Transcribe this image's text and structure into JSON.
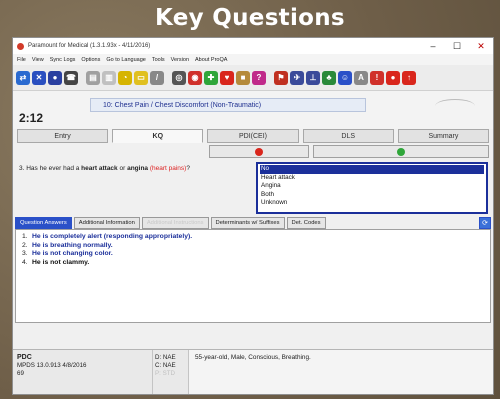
{
  "banner": {
    "title": "Key Questions"
  },
  "window": {
    "title": "Paramount for Medical (1.3.1.93x - 4/11/2016)",
    "controls": {
      "minimize": "–",
      "maximize": "☐",
      "close": "✕"
    }
  },
  "menu": [
    "File",
    "View",
    "Sync Logs",
    "Options",
    "Go to Language",
    "Tools",
    "Version",
    "About ProQA"
  ],
  "toolbar": {
    "icons": [
      {
        "name": "arrows-icon",
        "color": "#2a6ad0",
        "glyph": "⇄"
      },
      {
        "name": "cancel-icon",
        "color": "#2a4fc0",
        "glyph": "✕"
      },
      {
        "name": "case-icon",
        "color": "#2a3fa0",
        "glyph": "●"
      },
      {
        "name": "phone-icon",
        "color": "#444444",
        "glyph": "☎"
      },
      {
        "name": "notes-icon",
        "color": "#a0a0a0",
        "glyph": "▤"
      },
      {
        "name": "pdi-icon",
        "color": "#c0c0c0",
        "glyph": "▥"
      },
      {
        "name": "timer-icon",
        "color": "#d6b400",
        "glyph": "◔"
      },
      {
        "name": "card-icon",
        "color": "#e0c020",
        "glyph": "▭"
      },
      {
        "name": "pen-icon",
        "color": "#888888",
        "glyph": "/"
      },
      {
        "name": "record-icon",
        "color": "#555555",
        "glyph": "◎"
      },
      {
        "name": "recorder-icon",
        "color": "#d0302a",
        "glyph": "◉"
      },
      {
        "name": "aed-icon",
        "color": "#2fa63a",
        "glyph": "✚"
      },
      {
        "name": "heart-icon",
        "color": "#d9261c",
        "glyph": "♥"
      },
      {
        "name": "chest-icon",
        "color": "#b58a3a",
        "glyph": "■"
      },
      {
        "name": "help-icon",
        "color": "#c02a8a",
        "glyph": "?"
      },
      {
        "name": "flag-icon",
        "color": "#c03020",
        "glyph": "⚑"
      },
      {
        "name": "plane-icon",
        "color": "#3a4a9a",
        "glyph": "✈"
      },
      {
        "name": "unit-icon",
        "color": "#3a4a9a",
        "glyph": "⊥"
      },
      {
        "name": "map-icon",
        "color": "#2a8a3a",
        "glyph": "♣"
      },
      {
        "name": "globe-icon",
        "color": "#2a50c8",
        "glyph": "☺"
      },
      {
        "name": "font-icon",
        "color": "#888888",
        "glyph": "A"
      },
      {
        "name": "alert-icon",
        "color": "#d0302a",
        "glyph": "!"
      },
      {
        "name": "lock-icon",
        "color": "#d9261c",
        "glyph": "●"
      },
      {
        "name": "exit-icon",
        "color": "#d9261c",
        "glyph": "↑"
      }
    ]
  },
  "header": {
    "timer": "2:12",
    "case_title": "10: Chest Pain / Chest Discomfort (Non-Traumatic)"
  },
  "tabs": [
    {
      "label": "Entry",
      "active": false
    },
    {
      "label": "KQ",
      "active": true
    },
    {
      "label": "PDI(CEI)",
      "active": false
    },
    {
      "label": "DLS",
      "active": false
    },
    {
      "label": "Summary",
      "active": false
    }
  ],
  "question": {
    "number": "3.",
    "prefix": "Has he ever had a ",
    "bold1": "heart attack",
    "mid": " or ",
    "bold2": "angina",
    "suffix": " (heart pains)?",
    "red_suffix": "(heart pains)"
  },
  "answers": [
    "No",
    "Heart attack",
    "Angina",
    "Both",
    "Unknown"
  ],
  "selected_answer": 0,
  "bottom_tabs": [
    {
      "label": "Question Answers",
      "state": "active"
    },
    {
      "label": "Additional Information",
      "state": "normal"
    },
    {
      "label": "Additional Instructions",
      "state": "faded"
    },
    {
      "label": "Determinants w/ Suffixes",
      "state": "normal"
    },
    {
      "label": "Det. Codes",
      "state": "normal"
    }
  ],
  "kq_answers": [
    {
      "num": "1.",
      "text": "He is completely alert (responding appropriately).",
      "color": "blue"
    },
    {
      "num": "2.",
      "text": "He is breathing normally.",
      "color": "blue"
    },
    {
      "num": "3.",
      "text": "He is not changing color.",
      "color": "blue"
    },
    {
      "num": "4.",
      "text": "He is not clammy.",
      "color": "black"
    }
  ],
  "status": {
    "pdc": "PDC",
    "version": "MPDS 13.0.913 4/8/2016",
    "code": "69",
    "d_code": "D: NAE",
    "c_code": "C: NAE",
    "p_code": "P: STD",
    "summary": "55-year-old, Male, Conscious, Breathing."
  }
}
